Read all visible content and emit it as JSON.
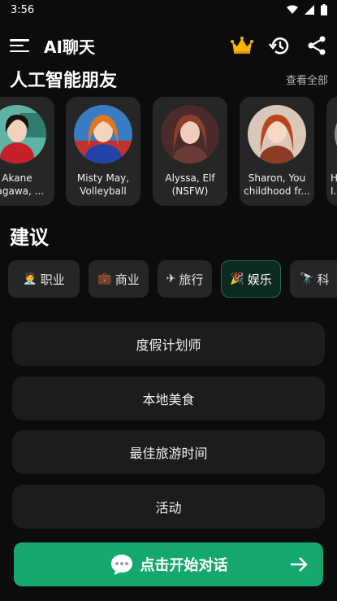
{
  "status_bar": {
    "time": "3:56"
  },
  "header": {
    "title": "AI聊天"
  },
  "friends_section": {
    "title": "人工智能朋友",
    "see_all": "查看全部",
    "friends": [
      {
        "name": "Akane\nnagawa, ..."
      },
      {
        "name": "Misty May, Volleyball pl..."
      },
      {
        "name": "Alyssa, Elf (NSFW)"
      },
      {
        "name": "Sharon, You childhood fr..."
      },
      {
        "name": "H\nI..."
      }
    ]
  },
  "suggestions": {
    "title": "建议",
    "categories": [
      {
        "label": "职业",
        "icon": "🧑‍💼"
      },
      {
        "label": "商业",
        "icon": "💼"
      },
      {
        "label": "旅行",
        "icon": "✈"
      },
      {
        "label": "娱乐",
        "icon": "🎉"
      },
      {
        "label": "科",
        "icon": "🔭"
      }
    ],
    "active_category": "娱乐",
    "items": [
      "度假计划师",
      "本地美食",
      "最佳旅游时间",
      "活动"
    ]
  },
  "cta": {
    "label": "点击开始对话"
  },
  "colors": {
    "accent": "#14a86f",
    "background": "#0c0c0c",
    "card": "#262626"
  }
}
